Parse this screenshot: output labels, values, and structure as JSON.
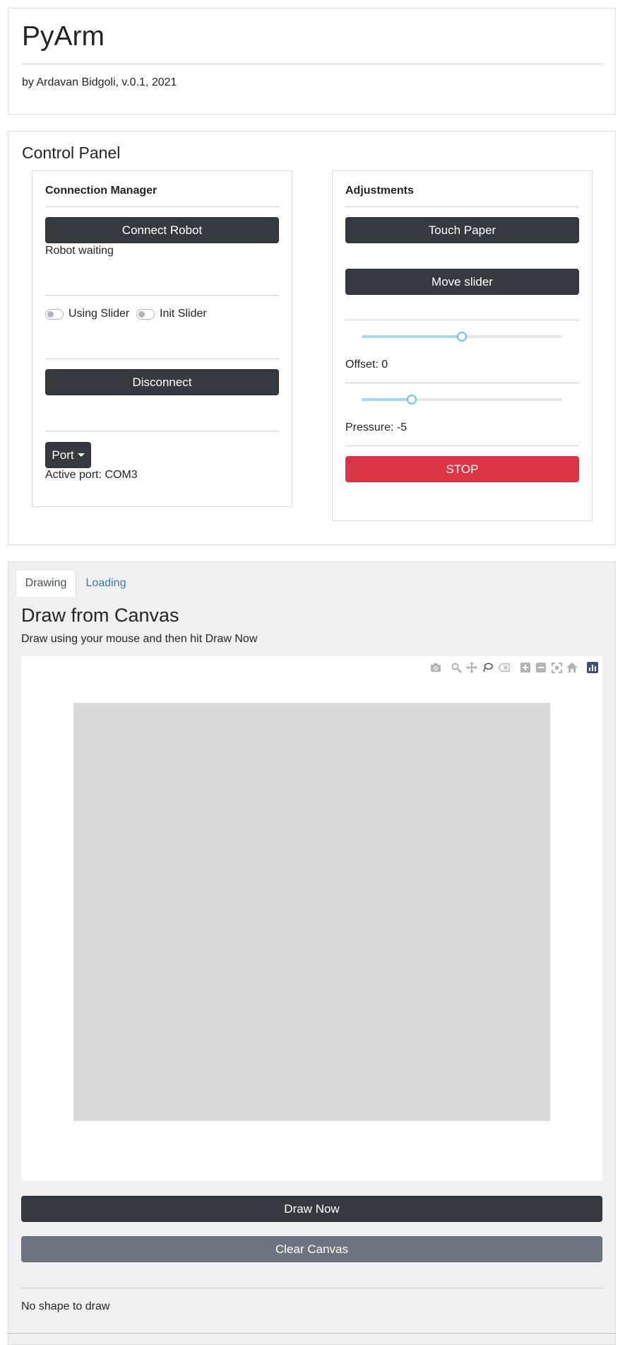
{
  "header": {
    "title": "PyArm",
    "byline": "by Ardavan Bidgoli, v.0.1, 2021"
  },
  "control_panel": {
    "title": "Control Panel",
    "connection": {
      "title": "Connection Manager",
      "connect_label": "Connect Robot",
      "status": "Robot waiting",
      "using_slider_label": "Using Slider",
      "init_slider_label": "Init Slider",
      "disconnect_label": "Disconnect",
      "port_label": "Port",
      "active_port": "Active port: COM3"
    },
    "adjustments": {
      "title": "Adjustments",
      "touch_paper_label": "Touch Paper",
      "move_slider_label": "Move slider",
      "offset_text": "Offset: 0",
      "offset_value": 0,
      "offset_fraction": 0.5,
      "pressure_text": "Pressure: -5",
      "pressure_value": -5,
      "pressure_fraction": 0.25,
      "stop_label": "STOP"
    }
  },
  "tabs": [
    {
      "label": "Drawing",
      "active": true
    },
    {
      "label": "Loading",
      "active": false
    }
  ],
  "drawing": {
    "title": "Draw from Canvas",
    "instructions": "Draw using your mouse and then hit Draw Now",
    "toolbar_icons": [
      "camera-icon",
      "zoom-icon",
      "pan-icon",
      "lasso-icon",
      "erase-icon",
      "zoom-in-icon",
      "zoom-out-icon",
      "autoscale-icon",
      "reset-axes-icon",
      "plotly-logo-icon"
    ],
    "draw_now_label": "Draw Now",
    "clear_label": "Clear Canvas",
    "status": "No shape to draw"
  },
  "colors": {
    "dark": "#343a40",
    "danger": "#dc3545",
    "secondary": "#6c757d",
    "link": "#337ab7",
    "canvas": "#dadada"
  }
}
